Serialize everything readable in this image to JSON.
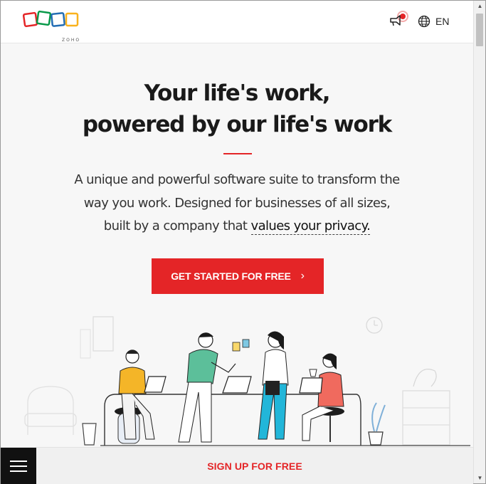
{
  "header": {
    "logo_wordmark": "ZOHO",
    "lang_label": "EN"
  },
  "hero": {
    "headline_line1": "Your life's work,",
    "headline_line2": "powered by our life's work",
    "sub_line1": "A unique and powerful software suite to transform the",
    "sub_line2": "way you work. Designed for businesses of all sizes,",
    "sub_line3_prefix": "built by a company that ",
    "privacy_link": "values your privacy.",
    "cta_label": "GET STARTED FOR FREE",
    "cta_arrow": "›"
  },
  "bottom_bar": {
    "signup_label": "SIGN UP FOR FREE"
  },
  "icons": [
    "announcement-icon",
    "globe-icon",
    "chevron-right-icon",
    "hamburger-menu-icon"
  ],
  "colors": {
    "brand_red": "#e42527",
    "logo_red": "#e42527",
    "logo_green": "#089949",
    "logo_blue": "#226db4",
    "logo_yellow": "#f9b21d",
    "text_dark": "#1a1a1a"
  }
}
